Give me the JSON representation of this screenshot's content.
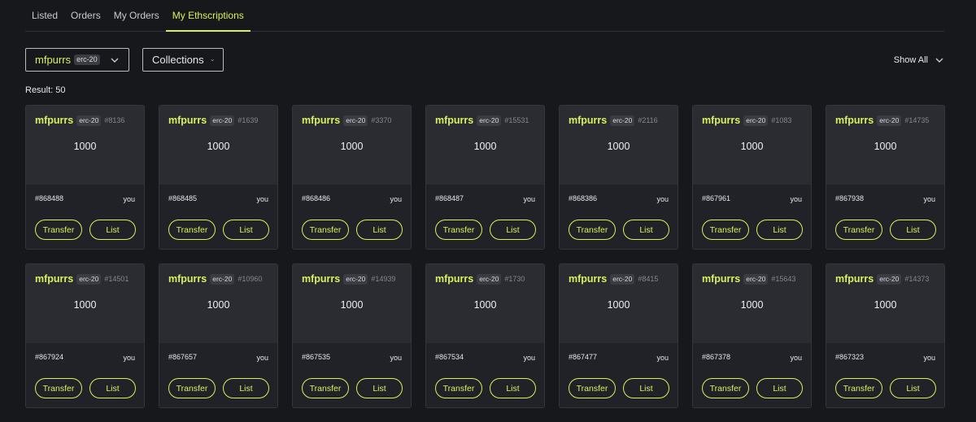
{
  "tabs": [
    {
      "label": "Listed"
    },
    {
      "label": "Orders"
    },
    {
      "label": "My Orders"
    },
    {
      "label": "My Ethscriptions"
    }
  ],
  "filters": {
    "token": {
      "tick": "mfpurrs",
      "chip": "erc-20"
    },
    "collections": {
      "label": "Collections"
    },
    "show_all": {
      "label": "Show All"
    }
  },
  "result_label": "Result: 50",
  "colors": {
    "accent": "#d8f15b",
    "background": "#17181c",
    "card": "#2a2c32"
  },
  "icons": {
    "dropdown": "chevron-down-icon"
  },
  "cards": [
    {
      "tick": "mfpurrs",
      "chip": "erc-20",
      "token_id": "#8136",
      "amount": "1000",
      "inscription": "#868488",
      "owner": "you",
      "transfer": "Transfer",
      "list": "List"
    },
    {
      "tick": "mfpurrs",
      "chip": "erc-20",
      "token_id": "#1639",
      "amount": "1000",
      "inscription": "#868485",
      "owner": "you",
      "transfer": "Transfer",
      "list": "List"
    },
    {
      "tick": "mfpurrs",
      "chip": "erc-20",
      "token_id": "#3370",
      "amount": "1000",
      "inscription": "#868486",
      "owner": "you",
      "transfer": "Transfer",
      "list": "List"
    },
    {
      "tick": "mfpurrs",
      "chip": "erc-20",
      "token_id": "#15531",
      "amount": "1000",
      "inscription": "#868487",
      "owner": "you",
      "transfer": "Transfer",
      "list": "List"
    },
    {
      "tick": "mfpurrs",
      "chip": "erc-20",
      "token_id": "#2116",
      "amount": "1000",
      "inscription": "#868386",
      "owner": "you",
      "transfer": "Transfer",
      "list": "List"
    },
    {
      "tick": "mfpurrs",
      "chip": "erc-20",
      "token_id": "#1083",
      "amount": "1000",
      "inscription": "#867961",
      "owner": "you",
      "transfer": "Transfer",
      "list": "List"
    },
    {
      "tick": "mfpurrs",
      "chip": "erc-20",
      "token_id": "#14735",
      "amount": "1000",
      "inscription": "#867938",
      "owner": "you",
      "transfer": "Transfer",
      "list": "List"
    },
    {
      "tick": "mfpurrs",
      "chip": "erc-20",
      "token_id": "#14501",
      "amount": "1000",
      "inscription": "#867924",
      "owner": "you",
      "transfer": "Transfer",
      "list": "List"
    },
    {
      "tick": "mfpurrs",
      "chip": "erc-20",
      "token_id": "#10960",
      "amount": "1000",
      "inscription": "#867657",
      "owner": "you",
      "transfer": "Transfer",
      "list": "List"
    },
    {
      "tick": "mfpurrs",
      "chip": "erc-20",
      "token_id": "#14939",
      "amount": "1000",
      "inscription": "#867535",
      "owner": "you",
      "transfer": "Transfer",
      "list": "List"
    },
    {
      "tick": "mfpurrs",
      "chip": "erc-20",
      "token_id": "#1730",
      "amount": "1000",
      "inscription": "#867534",
      "owner": "you",
      "transfer": "Transfer",
      "list": "List"
    },
    {
      "tick": "mfpurrs",
      "chip": "erc-20",
      "token_id": "#8415",
      "amount": "1000",
      "inscription": "#867477",
      "owner": "you",
      "transfer": "Transfer",
      "list": "List"
    },
    {
      "tick": "mfpurrs",
      "chip": "erc-20",
      "token_id": "#15643",
      "amount": "1000",
      "inscription": "#867378",
      "owner": "you",
      "transfer": "Transfer",
      "list": "List"
    },
    {
      "tick": "mfpurrs",
      "chip": "erc-20",
      "token_id": "#14373",
      "amount": "1000",
      "inscription": "#867323",
      "owner": "you",
      "transfer": "Transfer",
      "list": "List"
    }
  ]
}
